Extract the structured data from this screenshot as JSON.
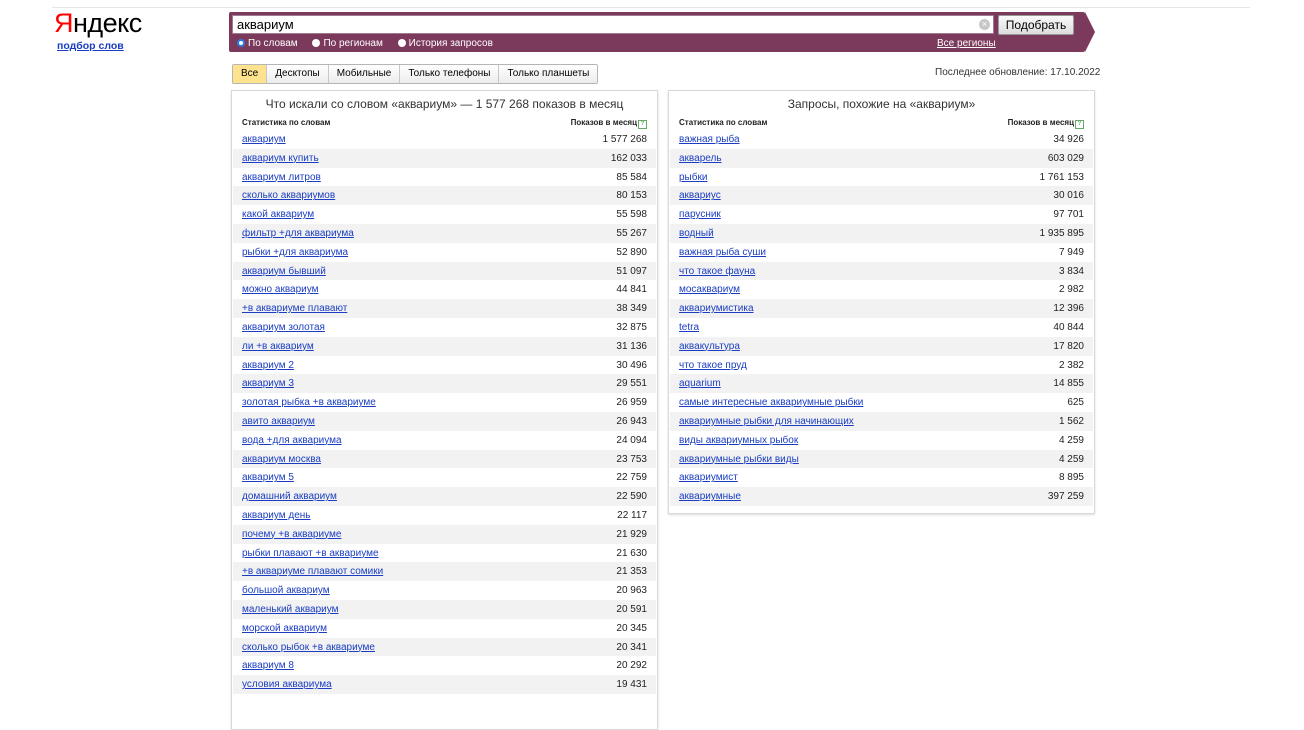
{
  "logo": {
    "text_red": "Я",
    "text_black": "ндекс",
    "subtitle": "подбор слов"
  },
  "search": {
    "value": "аквариум",
    "button_label": "Подобрать",
    "clear_symbol": "×"
  },
  "radios": [
    {
      "label": "По словам",
      "selected": true
    },
    {
      "label": "По регионам",
      "selected": false
    },
    {
      "label": "История запросов",
      "selected": false
    }
  ],
  "all_regions_label": "Все регионы",
  "tabs": [
    {
      "label": "Все",
      "active": true
    },
    {
      "label": "Десктопы",
      "active": false
    },
    {
      "label": "Мобильные",
      "active": false
    },
    {
      "label": "Только телефоны",
      "active": false
    },
    {
      "label": "Только планшеты",
      "active": false
    }
  ],
  "last_update": "Последнее обновление: 17.10.2022",
  "left_panel": {
    "title": "Что искали со словом «аквариум» — 1 577 268 показов в месяц",
    "col_words": "Статистика по словам",
    "col_count": "Показов в месяц",
    "help": "?",
    "rows": [
      [
        "аквариум",
        "1 577 268"
      ],
      [
        "аквариум купить",
        "162 033"
      ],
      [
        "аквариум литров",
        "85 584"
      ],
      [
        "сколько аквариумов",
        "80 153"
      ],
      [
        "какой аквариум",
        "55 598"
      ],
      [
        "фильтр +для аквариума",
        "55 267"
      ],
      [
        "рыбки +для аквариума",
        "52 890"
      ],
      [
        "аквариум бывший",
        "51 097"
      ],
      [
        "можно аквариум",
        "44 841"
      ],
      [
        "+в аквариуме плавают",
        "38 349"
      ],
      [
        "аквариум золотая",
        "32 875"
      ],
      [
        "ли +в аквариум",
        "31 136"
      ],
      [
        "аквариум 2",
        "30 496"
      ],
      [
        "аквариум 3",
        "29 551"
      ],
      [
        "золотая рыбка +в аквариуме",
        "26 959"
      ],
      [
        "авито аквариум",
        "26 943"
      ],
      [
        "вода +для аквариума",
        "24 094"
      ],
      [
        "аквариум москва",
        "23 753"
      ],
      [
        "аквариум 5",
        "22 759"
      ],
      [
        "домашний аквариум",
        "22 590"
      ],
      [
        "аквариум день",
        "22 117"
      ],
      [
        "почему +в аквариуме",
        "21 929"
      ],
      [
        "рыбки плавают +в аквариуме",
        "21 630"
      ],
      [
        "+в аквариуме плавают сомики",
        "21 353"
      ],
      [
        "большой аквариум",
        "20 963"
      ],
      [
        "маленький аквариум",
        "20 591"
      ],
      [
        "морской аквариум",
        "20 345"
      ],
      [
        "сколько рыбок +в аквариуме",
        "20 341"
      ],
      [
        "аквариум 8",
        "20 292"
      ],
      [
        "условия аквариума",
        "19 431"
      ]
    ]
  },
  "right_panel": {
    "title": "Запросы, похожие на «аквариум»",
    "col_words": "Статистика по словам",
    "col_count": "Показов в месяц",
    "help": "?",
    "rows": [
      [
        "важная рыба",
        "34 926"
      ],
      [
        "акварель",
        "603 029"
      ],
      [
        "рыбки",
        "1 761 153"
      ],
      [
        "аквариус",
        "30 016"
      ],
      [
        "парусник",
        "97 701"
      ],
      [
        "водный",
        "1 935 895"
      ],
      [
        "важная рыба суши",
        "7 949"
      ],
      [
        "что такое фауна",
        "3 834"
      ],
      [
        "мосаквариум",
        "2 982"
      ],
      [
        "аквариумистика",
        "12 396"
      ],
      [
        "tetra",
        "40 844"
      ],
      [
        "аквакультура",
        "17 820"
      ],
      [
        "что такое пруд",
        "2 382"
      ],
      [
        "aquarium",
        "14 855"
      ],
      [
        "самые интересные аквариумные рыбки",
        "625"
      ],
      [
        "аквариумные рыбки для начинающих",
        "1 562"
      ],
      [
        "виды аквариумных рыбок",
        "4 259"
      ],
      [
        "аквариумные рыбки виды",
        "4 259"
      ],
      [
        "аквариумист",
        "8 895"
      ],
      [
        "аквариумные",
        "397 259"
      ]
    ]
  }
}
